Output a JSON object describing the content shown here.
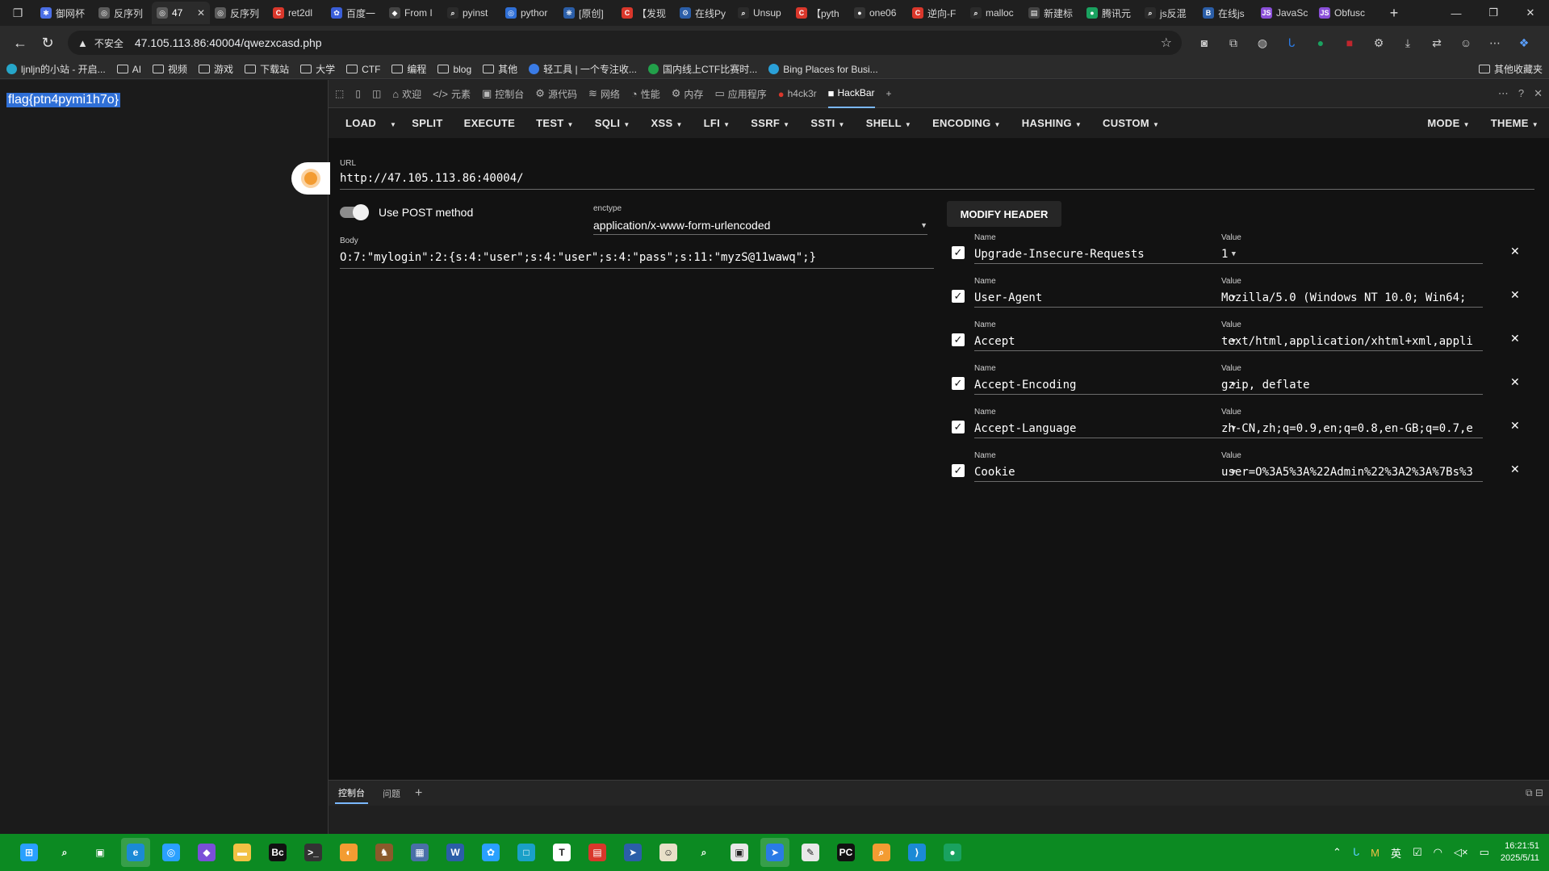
{
  "tabs": [
    {
      "label": "御网杯",
      "color": "#4b6fe6",
      "glyph": "✱"
    },
    {
      "label": "反序列",
      "color": "#5c5c5c",
      "glyph": "◎"
    },
    {
      "label": "47",
      "color": "#5c5c5c",
      "glyph": "◎",
      "active": true
    },
    {
      "label": "反序列",
      "color": "#5c5c5c",
      "glyph": "◎"
    },
    {
      "label": "ret2dl",
      "color": "#d9372b",
      "glyph": "C"
    },
    {
      "label": "百度一",
      "color": "#3a5ed8",
      "glyph": "✿"
    },
    {
      "label": "From I",
      "color": "#444",
      "glyph": "◆"
    },
    {
      "label": "pyinst",
      "color": "#2b2b2b",
      "glyph": "⌕"
    },
    {
      "label": "pythor",
      "color": "#2f6fd6",
      "glyph": "◎"
    },
    {
      "label": "[原创]",
      "color": "#2b5ea8",
      "glyph": "❋"
    },
    {
      "label": "【发现",
      "color": "#d9372b",
      "glyph": "C"
    },
    {
      "label": "在线Py",
      "color": "#2b5ea8",
      "glyph": "⚙"
    },
    {
      "label": "Unsup",
      "color": "#2b2b2b",
      "glyph": "⌕"
    },
    {
      "label": "【pyth",
      "color": "#d9372b",
      "glyph": "C"
    },
    {
      "label": "one06",
      "color": "#333",
      "glyph": "●"
    },
    {
      "label": "逆向-F",
      "color": "#d9372b",
      "glyph": "C"
    },
    {
      "label": "malloc",
      "color": "#2b2b2b",
      "glyph": "⌕"
    },
    {
      "label": "新建标",
      "color": "#444",
      "glyph": "▤"
    },
    {
      "label": "腾讯元",
      "color": "#1aa260",
      "glyph": "●"
    },
    {
      "label": "js反混",
      "color": "#2b2b2b",
      "glyph": "⌕"
    },
    {
      "label": "在线js",
      "color": "#2b5ea8",
      "glyph": "B"
    },
    {
      "label": "JavaSc",
      "color": "#8a4fd8",
      "glyph": "JS"
    },
    {
      "label": "Obfusc",
      "color": "#8a4fd8",
      "glyph": "JS"
    }
  ],
  "address": {
    "insecure_label": "不安全",
    "url": "47.105.113.86:40004/qwezxcasd.php"
  },
  "bookmarks": [
    {
      "label": "ljnljn的小站 - 开启...",
      "kind": "dot",
      "color": "#26a6c9"
    },
    {
      "label": "AI",
      "kind": "folder"
    },
    {
      "label": "视频",
      "kind": "folder"
    },
    {
      "label": "游戏",
      "kind": "folder"
    },
    {
      "label": "下载站",
      "kind": "folder"
    },
    {
      "label": "大学",
      "kind": "folder"
    },
    {
      "label": "CTF",
      "kind": "folder"
    },
    {
      "label": "编程",
      "kind": "folder"
    },
    {
      "label": "blog",
      "kind": "folder"
    },
    {
      "label": "其他",
      "kind": "folder"
    },
    {
      "label": "轻工具 | 一个专注收...",
      "kind": "dot",
      "color": "#3a7be6"
    },
    {
      "label": "国内线上CTF比赛时...",
      "kind": "dot",
      "color": "#22a04a"
    },
    {
      "label": "Bing Places for Busi...",
      "kind": "dot",
      "color": "#2aa0d8"
    }
  ],
  "bookmarks_other": "其他收藏夹",
  "page": {
    "flag_text": "flag{ptn4pymi1h7o}"
  },
  "devtools_tabs": [
    {
      "label": "欢迎",
      "icon": "⌂"
    },
    {
      "label": "元素",
      "icon": "</>"
    },
    {
      "label": "控制台",
      "icon": "▣"
    },
    {
      "label": "源代码",
      "icon": "⚙"
    },
    {
      "label": "网络",
      "icon": "≋"
    },
    {
      "label": "性能",
      "icon": "◔"
    },
    {
      "label": "内存",
      "icon": "⚙"
    },
    {
      "label": "应用程序",
      "icon": "▭"
    },
    {
      "label": "h4ck3r",
      "icon": "●"
    },
    {
      "label": "HackBar",
      "icon": "■",
      "active": true
    }
  ],
  "hackbar": {
    "menu": [
      {
        "label": "LOAD",
        "caret": false
      },
      {
        "label": "",
        "caret": true
      },
      {
        "label": "SPLIT",
        "caret": false
      },
      {
        "label": "EXECUTE",
        "caret": false
      },
      {
        "label": "TEST",
        "caret": true
      },
      {
        "label": "SQLI",
        "caret": true
      },
      {
        "label": "XSS",
        "caret": true
      },
      {
        "label": "LFI",
        "caret": true
      },
      {
        "label": "SSRF",
        "caret": true
      },
      {
        "label": "SSTI",
        "caret": true
      },
      {
        "label": "SHELL",
        "caret": true
      },
      {
        "label": "ENCODING",
        "caret": true
      },
      {
        "label": "HASHING",
        "caret": true
      },
      {
        "label": "CUSTOM",
        "caret": true
      }
    ],
    "menu_right": [
      {
        "label": "MODE",
        "caret": true
      },
      {
        "label": "THEME",
        "caret": true
      }
    ],
    "url_label": "URL",
    "url_value": "http://47.105.113.86:40004/",
    "post_label": "Use POST method",
    "enctype_label": "enctype",
    "enctype_value": "application/x-www-form-urlencoded",
    "body_label": "Body",
    "body_value": "O:7:\"mylogin\":2:{s:4:\"user\";s:4:\"user\";s:4:\"pass\";s:11:\"myzS@11wawq\";}",
    "modify_header_label": "MODIFY HEADER",
    "name_label": "Name",
    "value_label": "Value",
    "headers": [
      {
        "name": "Upgrade-Insecure-Requests",
        "value": "1"
      },
      {
        "name": "User-Agent",
        "value": "Mozilla/5.0 (Windows NT 10.0; Win64;"
      },
      {
        "name": "Accept",
        "value": "text/html,application/xhtml+xml,appli"
      },
      {
        "name": "Accept-Encoding",
        "value": "gzip, deflate"
      },
      {
        "name": "Accept-Language",
        "value": "zh-CN,zh;q=0.9,en;q=0.8,en-GB;q=0.7,e"
      },
      {
        "name": "Cookie",
        "value": "user=O%3A5%3A%22Admin%22%3A2%3A%7Bs%3"
      }
    ]
  },
  "drawer": {
    "tabs": [
      "控制台",
      "问题"
    ]
  },
  "taskbar": {
    "icons": [
      {
        "name": "start-icon",
        "glyph": "⊞",
        "bg": "#2aa0ff"
      },
      {
        "name": "search-icon",
        "glyph": "⌕",
        "bg": ""
      },
      {
        "name": "task-view-icon",
        "glyph": "▣",
        "bg": ""
      },
      {
        "name": "edge-icon",
        "glyph": "e",
        "bg": "#1b8ad6",
        "active": true
      },
      {
        "name": "app-icon",
        "glyph": "◎",
        "bg": "#2aa0ff"
      },
      {
        "name": "app-icon",
        "glyph": "◆",
        "bg": "#7a4fd8"
      },
      {
        "name": "folder-icon",
        "glyph": "▬",
        "bg": "#f2c144"
      },
      {
        "name": "app-icon",
        "glyph": "Bc",
        "bg": "#111"
      },
      {
        "name": "terminal-icon",
        "glyph": ">_",
        "bg": "#333"
      },
      {
        "name": "app-icon",
        "glyph": "◐",
        "bg": "#f39c32"
      },
      {
        "name": "app-icon",
        "glyph": "♞",
        "bg": "#8a5a2b"
      },
      {
        "name": "app-icon",
        "glyph": "▦",
        "bg": "#4a6fa8"
      },
      {
        "name": "word-icon",
        "glyph": "W",
        "bg": "#2b5ea8"
      },
      {
        "name": "app-icon",
        "glyph": "✿",
        "bg": "#2aa0ff"
      },
      {
        "name": "app-icon",
        "glyph": "□",
        "bg": "#1aa0c8"
      },
      {
        "name": "app-icon",
        "glyph": "T",
        "bg": "#fff"
      },
      {
        "name": "app-icon",
        "glyph": "▤",
        "bg": "#d9372b"
      },
      {
        "name": "app-icon",
        "glyph": "➤",
        "bg": "#2b5ea8"
      },
      {
        "name": "app-icon",
        "glyph": "☺",
        "bg": "#e8e0c8"
      },
      {
        "name": "search-tool-icon",
        "glyph": "⌕",
        "bg": ""
      },
      {
        "name": "app-icon",
        "glyph": "▣",
        "bg": "#e8e8e8"
      },
      {
        "name": "app-icon",
        "glyph": "➤",
        "bg": "#2a7be6",
        "active": true
      },
      {
        "name": "app-icon",
        "glyph": "✎",
        "bg": "#e8e8e8"
      },
      {
        "name": "pycharm-icon",
        "glyph": "PC",
        "bg": "#111"
      },
      {
        "name": "app-icon",
        "glyph": "⌕",
        "bg": "#f39c32"
      },
      {
        "name": "vscode-icon",
        "glyph": "⟩",
        "bg": "#1b8ad6"
      },
      {
        "name": "wechat-icon",
        "glyph": "●",
        "bg": "#1aa260"
      }
    ],
    "tray": {
      "ime": "英",
      "time": "16:21:51",
      "date": "2025/5/11"
    }
  }
}
